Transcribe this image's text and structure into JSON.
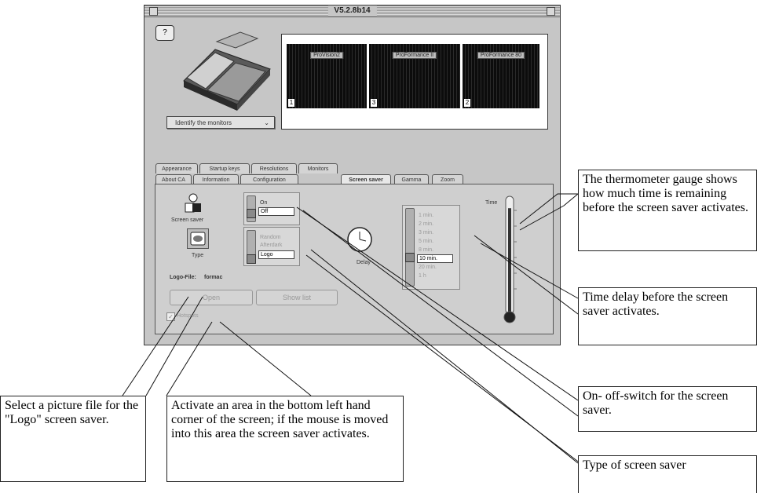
{
  "window": {
    "title": "V5.2.8b14"
  },
  "help_glyph": "?",
  "monitors": {
    "identify_button": "Identify the monitors",
    "identify_arrow": "⌄",
    "screens": [
      {
        "label": "ProVision2",
        "number": "1"
      },
      {
        "label": "ProFormance II",
        "number": "3"
      },
      {
        "label": "ProFormance 80",
        "number": "2"
      }
    ]
  },
  "tabs": {
    "back_row": [
      "Appearance",
      "Startup keys",
      "Resolutions",
      "Monitors"
    ],
    "front_row": [
      "About CA",
      "Information",
      "Configuration",
      "Screen saver",
      "Gamma",
      "Zoom"
    ],
    "active": "Screen saver"
  },
  "screen_saver": {
    "icon_label": "Screen saver",
    "onoff_options": [
      "On",
      "Off"
    ],
    "onoff_selected": "Off",
    "type_label": "Type",
    "type_options": [
      "Random",
      "Afterdark",
      "Logo"
    ],
    "type_selected": "Logo",
    "logo_file_label": "Logo-File:",
    "logo_file_value": "formac",
    "open_button": "Open",
    "show_button": "Show list",
    "hotspots_label": "Hotspots",
    "hotspots_checked": "✓",
    "delay_label": "Delay",
    "delay_options": [
      "1 min.",
      "2 min.",
      "3 min.",
      "5 min.",
      "8 min.",
      "10 min.",
      "20 min.",
      "1 h"
    ],
    "delay_selected": "10 min.",
    "time_label": "Time",
    "time_remaining_fraction": 0.95
  },
  "callouts": {
    "thermometer": "The thermometer gauge shows how much time is remaining before the screen saver activates.",
    "time_delay": "Time delay before the screen saver activates.",
    "onoff": "On- off-switch for the screen saver.",
    "type": "Type of screen saver",
    "picture": "Select a picture file for the \"Logo\" screen saver.",
    "hotspot": "Activate an area in the bottom left hand corner of the screen; if the mouse is moved into this area the screen saver activates."
  },
  "colors": {
    "window_bg": "#c6c6c6",
    "screen_bg": "#0c0c0c"
  }
}
